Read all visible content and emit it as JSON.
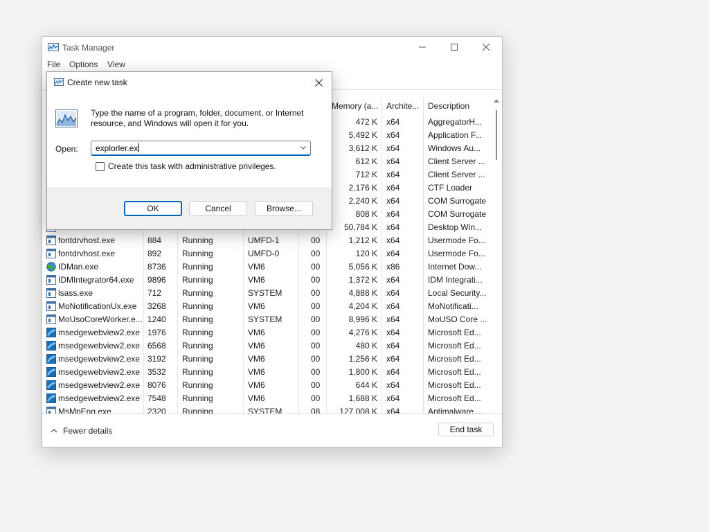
{
  "taskmanager": {
    "title": "Task Manager",
    "menu": [
      "File",
      "Options",
      "View"
    ],
    "columns": {
      "memory": "Memory (a...",
      "architecture": "Archite...",
      "description": "Description"
    },
    "rows": [
      {
        "name": "",
        "pid": "",
        "status": "",
        "user": "",
        "cpu": "",
        "memory": "472 K",
        "arch": "x64",
        "description": "AggregatorH...",
        "icon": "generic-app-icon"
      },
      {
        "name": "",
        "pid": "",
        "status": "",
        "user": "",
        "cpu": "",
        "memory": "5,492 K",
        "arch": "x64",
        "description": "Application F...",
        "icon": "generic-app-icon"
      },
      {
        "name": "",
        "pid": "",
        "status": "",
        "user": "",
        "cpu": "",
        "memory": "3,612 K",
        "arch": "x64",
        "description": "Windows Au...",
        "icon": "generic-app-icon"
      },
      {
        "name": "",
        "pid": "",
        "status": "",
        "user": "",
        "cpu": "",
        "memory": "612 K",
        "arch": "x64",
        "description": "Client Server ...",
        "icon": "generic-app-icon"
      },
      {
        "name": "",
        "pid": "",
        "status": "",
        "user": "",
        "cpu": "",
        "memory": "712 K",
        "arch": "x64",
        "description": "Client Server ...",
        "icon": "generic-app-icon"
      },
      {
        "name": "",
        "pid": "",
        "status": "",
        "user": "",
        "cpu": "",
        "memory": "2,176 K",
        "arch": "x64",
        "description": "CTF Loader",
        "icon": "generic-app-icon"
      },
      {
        "name": "",
        "pid": "",
        "status": "",
        "user": "",
        "cpu": "",
        "memory": "2,240 K",
        "arch": "x64",
        "description": "COM Surrogate",
        "icon": "generic-app-icon"
      },
      {
        "name": "",
        "pid": "",
        "status": "",
        "user": "",
        "cpu": "",
        "memory": "808 K",
        "arch": "x64",
        "description": "COM Surrogate",
        "icon": "generic-app-icon"
      },
      {
        "name": "",
        "pid": "",
        "status": "",
        "user": "",
        "cpu": "",
        "memory": "50,784 K",
        "arch": "x64",
        "description": "Desktop Win...",
        "icon": "generic-app-icon"
      },
      {
        "name": "fontdrvhost.exe",
        "pid": "884",
        "status": "Running",
        "user": "UMFD-1",
        "cpu": "00",
        "memory": "1,212 K",
        "arch": "x64",
        "description": "Usermode Fo...",
        "icon": "generic-app-icon"
      },
      {
        "name": "fontdrvhost.exe",
        "pid": "892",
        "status": "Running",
        "user": "UMFD-0",
        "cpu": "00",
        "memory": "120 K",
        "arch": "x64",
        "description": "Usermode Fo...",
        "icon": "generic-app-icon"
      },
      {
        "name": "IDMan.exe",
        "pid": "8736",
        "status": "Running",
        "user": "VM6",
        "cpu": "00",
        "memory": "5,056 K",
        "arch": "x86",
        "description": "Internet Dow...",
        "icon": "globe-icon"
      },
      {
        "name": "IDMIntegrator64.exe",
        "pid": "9896",
        "status": "Running",
        "user": "VM6",
        "cpu": "00",
        "memory": "1,372 K",
        "arch": "x64",
        "description": "IDM Integrati...",
        "icon": "generic-app-icon"
      },
      {
        "name": "lsass.exe",
        "pid": "712",
        "status": "Running",
        "user": "SYSTEM",
        "cpu": "00",
        "memory": "4,888 K",
        "arch": "x64",
        "description": "Local Security...",
        "icon": "generic-app-icon"
      },
      {
        "name": "MoNotificationUx.exe",
        "pid": "3268",
        "status": "Running",
        "user": "VM6",
        "cpu": "00",
        "memory": "4,204 K",
        "arch": "x64",
        "description": "MoNotificati...",
        "icon": "generic-app-icon"
      },
      {
        "name": "MoUsoCoreWorker.e...",
        "pid": "1240",
        "status": "Running",
        "user": "SYSTEM",
        "cpu": "00",
        "memory": "8,996 K",
        "arch": "x64",
        "description": "MoUSO Core ...",
        "icon": "generic-app-icon"
      },
      {
        "name": "msedgewebview2.exe",
        "pid": "1976",
        "status": "Running",
        "user": "VM6",
        "cpu": "00",
        "memory": "4,276 K",
        "arch": "x64",
        "description": "Microsoft Ed...",
        "icon": "edge-webview-icon"
      },
      {
        "name": "msedgewebview2.exe",
        "pid": "6568",
        "status": "Running",
        "user": "VM6",
        "cpu": "00",
        "memory": "480 K",
        "arch": "x64",
        "description": "Microsoft Ed...",
        "icon": "edge-webview-icon"
      },
      {
        "name": "msedgewebview2.exe",
        "pid": "3192",
        "status": "Running",
        "user": "VM6",
        "cpu": "00",
        "memory": "1,256 K",
        "arch": "x64",
        "description": "Microsoft Ed...",
        "icon": "edge-webview-icon"
      },
      {
        "name": "msedgewebview2.exe",
        "pid": "3532",
        "status": "Running",
        "user": "VM6",
        "cpu": "00",
        "memory": "1,800 K",
        "arch": "x64",
        "description": "Microsoft Ed...",
        "icon": "edge-webview-icon"
      },
      {
        "name": "msedgewebview2.exe",
        "pid": "8076",
        "status": "Running",
        "user": "VM6",
        "cpu": "00",
        "memory": "644 K",
        "arch": "x64",
        "description": "Microsoft Ed...",
        "icon": "edge-webview-icon"
      },
      {
        "name": "msedgewebview2.exe",
        "pid": "7548",
        "status": "Running",
        "user": "VM6",
        "cpu": "00",
        "memory": "1,688 K",
        "arch": "x64",
        "description": "Microsoft Ed...",
        "icon": "edge-webview-icon"
      },
      {
        "name": "MsMpEng.exe",
        "pid": "2320",
        "status": "Running",
        "user": "SYSTEM",
        "cpu": "08",
        "memory": "127,008 K",
        "arch": "x64",
        "description": "Antimalware ...",
        "icon": "generic-app-icon"
      }
    ],
    "footer": {
      "fewer_details": "Fewer details",
      "end_task": "End task"
    }
  },
  "dialog": {
    "title": "Create new task",
    "description": "Type the name of a program, folder, document, or Internet resource, and Windows will open it for you.",
    "open_label": "Open:",
    "open_value": "explorler.ex",
    "admin_label": "Create this task with administrative privileges.",
    "admin_checked": false,
    "buttons": {
      "ok": "OK",
      "cancel": "Cancel",
      "browse": "Browse..."
    }
  },
  "colors": {
    "accent": "#0067c0",
    "window_bg": "#ffffff",
    "dialog_footer_bg": "#f0f0f0"
  }
}
